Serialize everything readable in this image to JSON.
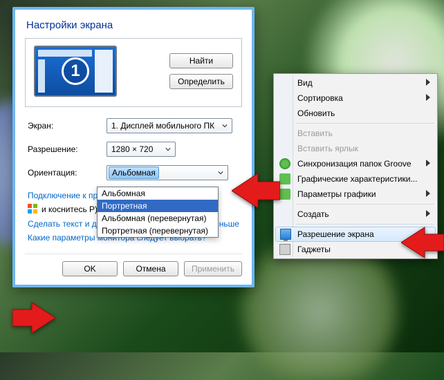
{
  "dialog": {
    "title": "Настройки экрана",
    "find_btn": "Найти",
    "detect_btn": "Определить",
    "monitor_number": "1",
    "screen_label": "Экран:",
    "screen_value": "1. Дисплей мобильного ПК",
    "resolution_label": "Разрешение:",
    "resolution_value": "1280 × 720",
    "orientation_label": "Ориентация:",
    "orientation_value": "Альбомная",
    "orientation_options": [
      "Альбомная",
      "Портретная",
      "Альбомная (перевернутая)",
      "Портретная (перевернутая)"
    ],
    "orientation_selected_index": 1,
    "projector_link": "Подключение к проек",
    "projector_hint": "и коснитесь P)",
    "text_size_link": "Сделать текст и другие элементы больше или меньше",
    "monitor_params_link": "Какие параметры монитора следует выбрать?",
    "ok_btn": "OK",
    "cancel_btn": "Отмена",
    "apply_btn": "Применить"
  },
  "context_menu": {
    "items": [
      {
        "label": "Вид",
        "submenu": true
      },
      {
        "label": "Сортировка",
        "submenu": true
      },
      {
        "label": "Обновить"
      },
      {
        "sep": true
      },
      {
        "label": "Вставить",
        "disabled": true
      },
      {
        "label": "Вставить ярлык",
        "disabled": true
      },
      {
        "label": "Синхронизация папок Groove",
        "icon": "sync",
        "submenu": true
      },
      {
        "label": "Графические характеристики...",
        "icon": "green"
      },
      {
        "label": "Параметры графики",
        "icon": "green",
        "submenu": true
      },
      {
        "sep": true
      },
      {
        "label": "Создать",
        "submenu": true
      },
      {
        "sep": true
      },
      {
        "label": "Разрешение экрана",
        "icon": "monitor",
        "hover": true
      },
      {
        "label": "Гаджеты",
        "icon": "gadget"
      }
    ]
  }
}
